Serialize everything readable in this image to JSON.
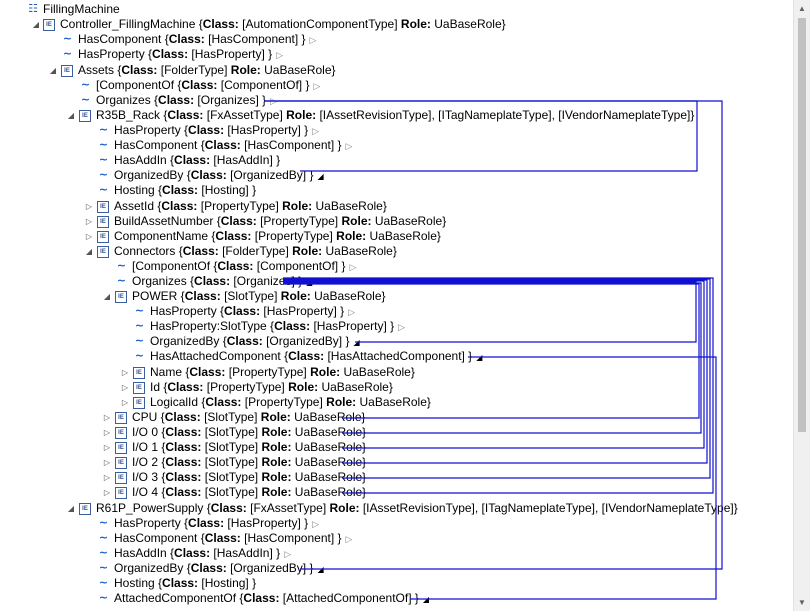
{
  "tree": {
    "root": "FillingMachine",
    "controller": {
      "name": "Controller_FillingMachine",
      "class": "[AutomationComponentType]",
      "role": "UaBaseRole"
    },
    "controller_refs": [
      {
        "name": "HasComponent",
        "class": "[HasComponent]"
      },
      {
        "name": "HasProperty",
        "class": "[HasProperty]"
      }
    ],
    "assets": {
      "name": "Assets",
      "class": "[FolderType]",
      "role": "UaBaseRole"
    },
    "assets_refs": [
      {
        "name": "[ComponentOf",
        "class": "[ComponentOf]"
      },
      {
        "name": "Organizes",
        "class": "[Organizes]"
      }
    ],
    "rack": {
      "name": "R35B_Rack",
      "class": "[FxAssetType]",
      "role": "[IAssetRevisionType], [ITagNameplateType], [IVendorNameplateType]"
    },
    "rack_refs": [
      {
        "name": "HasProperty",
        "class": "[HasProperty]"
      },
      {
        "name": "HasComponent",
        "class": "[HasComponent]"
      },
      {
        "name": "HasAddIn",
        "class": "[HasAddIn]"
      },
      {
        "name": "OrganizedBy",
        "class": "[OrganizedBy]"
      },
      {
        "name": "Hosting",
        "class": "[Hosting]"
      }
    ],
    "rack_props": [
      {
        "name": "AssetId",
        "class": "[PropertyType]",
        "role": "UaBaseRole"
      },
      {
        "name": "BuildAssetNumber",
        "class": "[PropertyType]",
        "role": "UaBaseRole"
      },
      {
        "name": "ComponentName",
        "class": "[PropertyType]",
        "role": "UaBaseRole"
      }
    ],
    "connectors": {
      "name": "Connectors",
      "class": "[FolderType]",
      "role": "UaBaseRole"
    },
    "connectors_refs": [
      {
        "name": "[ComponentOf",
        "class": "[ComponentOf]"
      },
      {
        "name": "Organizes",
        "class": "[Organizes]"
      }
    ],
    "power": {
      "name": "POWER",
      "class": "[SlotType]",
      "role": "UaBaseRole"
    },
    "power_refs": [
      {
        "name": "HasProperty",
        "class": "[HasProperty]"
      },
      {
        "name": "HasProperty:SlotType",
        "class": "[HasProperty]"
      },
      {
        "name": "OrganizedBy",
        "class": "[OrganizedBy]"
      },
      {
        "name": "HasAttachedComponent",
        "class": "[HasAttachedComponent]"
      }
    ],
    "power_props": [
      {
        "name": "Name",
        "class": "[PropertyType]",
        "role": "UaBaseRole"
      },
      {
        "name": "Id",
        "class": "[PropertyType]",
        "role": "UaBaseRole"
      },
      {
        "name": "LogicalId",
        "class": "[PropertyType]",
        "role": "UaBaseRole"
      }
    ],
    "slots": [
      {
        "name": "CPU",
        "class": "[SlotType]",
        "role": "UaBaseRole"
      },
      {
        "name": "I/O 0",
        "class": "[SlotType]",
        "role": "UaBaseRole"
      },
      {
        "name": "I/O 1",
        "class": "[SlotType]",
        "role": "UaBaseRole"
      },
      {
        "name": "I/O 2",
        "class": "[SlotType]",
        "role": "UaBaseRole"
      },
      {
        "name": "I/O 3",
        "class": "[SlotType]",
        "role": "UaBaseRole"
      },
      {
        "name": "I/O 4",
        "class": "[SlotType]",
        "role": "UaBaseRole"
      }
    ],
    "psu": {
      "name": "R61P_PowerSupply",
      "class": "[FxAssetType]",
      "role": "[IAssetRevisionType], [ITagNameplateType], [IVendorNameplateType]"
    },
    "psu_refs": [
      {
        "name": "HasProperty",
        "class": "[HasProperty]"
      },
      {
        "name": "HasComponent",
        "class": "[HasComponent]"
      },
      {
        "name": "HasAddIn",
        "class": "[HasAddIn]"
      },
      {
        "name": "OrganizedBy",
        "class": "[OrganizedBy]"
      },
      {
        "name": "Hosting",
        "class": "[Hosting]"
      },
      {
        "name": "AttachedComponentOf",
        "class": "[AttachedComponentOf]"
      }
    ]
  },
  "strings": {
    "class_key": "Class:",
    "role_key": "Role:"
  },
  "colors": {
    "connector_line": "#1010d0",
    "link_icon": "#2060c0",
    "scroll_thumb": "#c1c1c1"
  }
}
